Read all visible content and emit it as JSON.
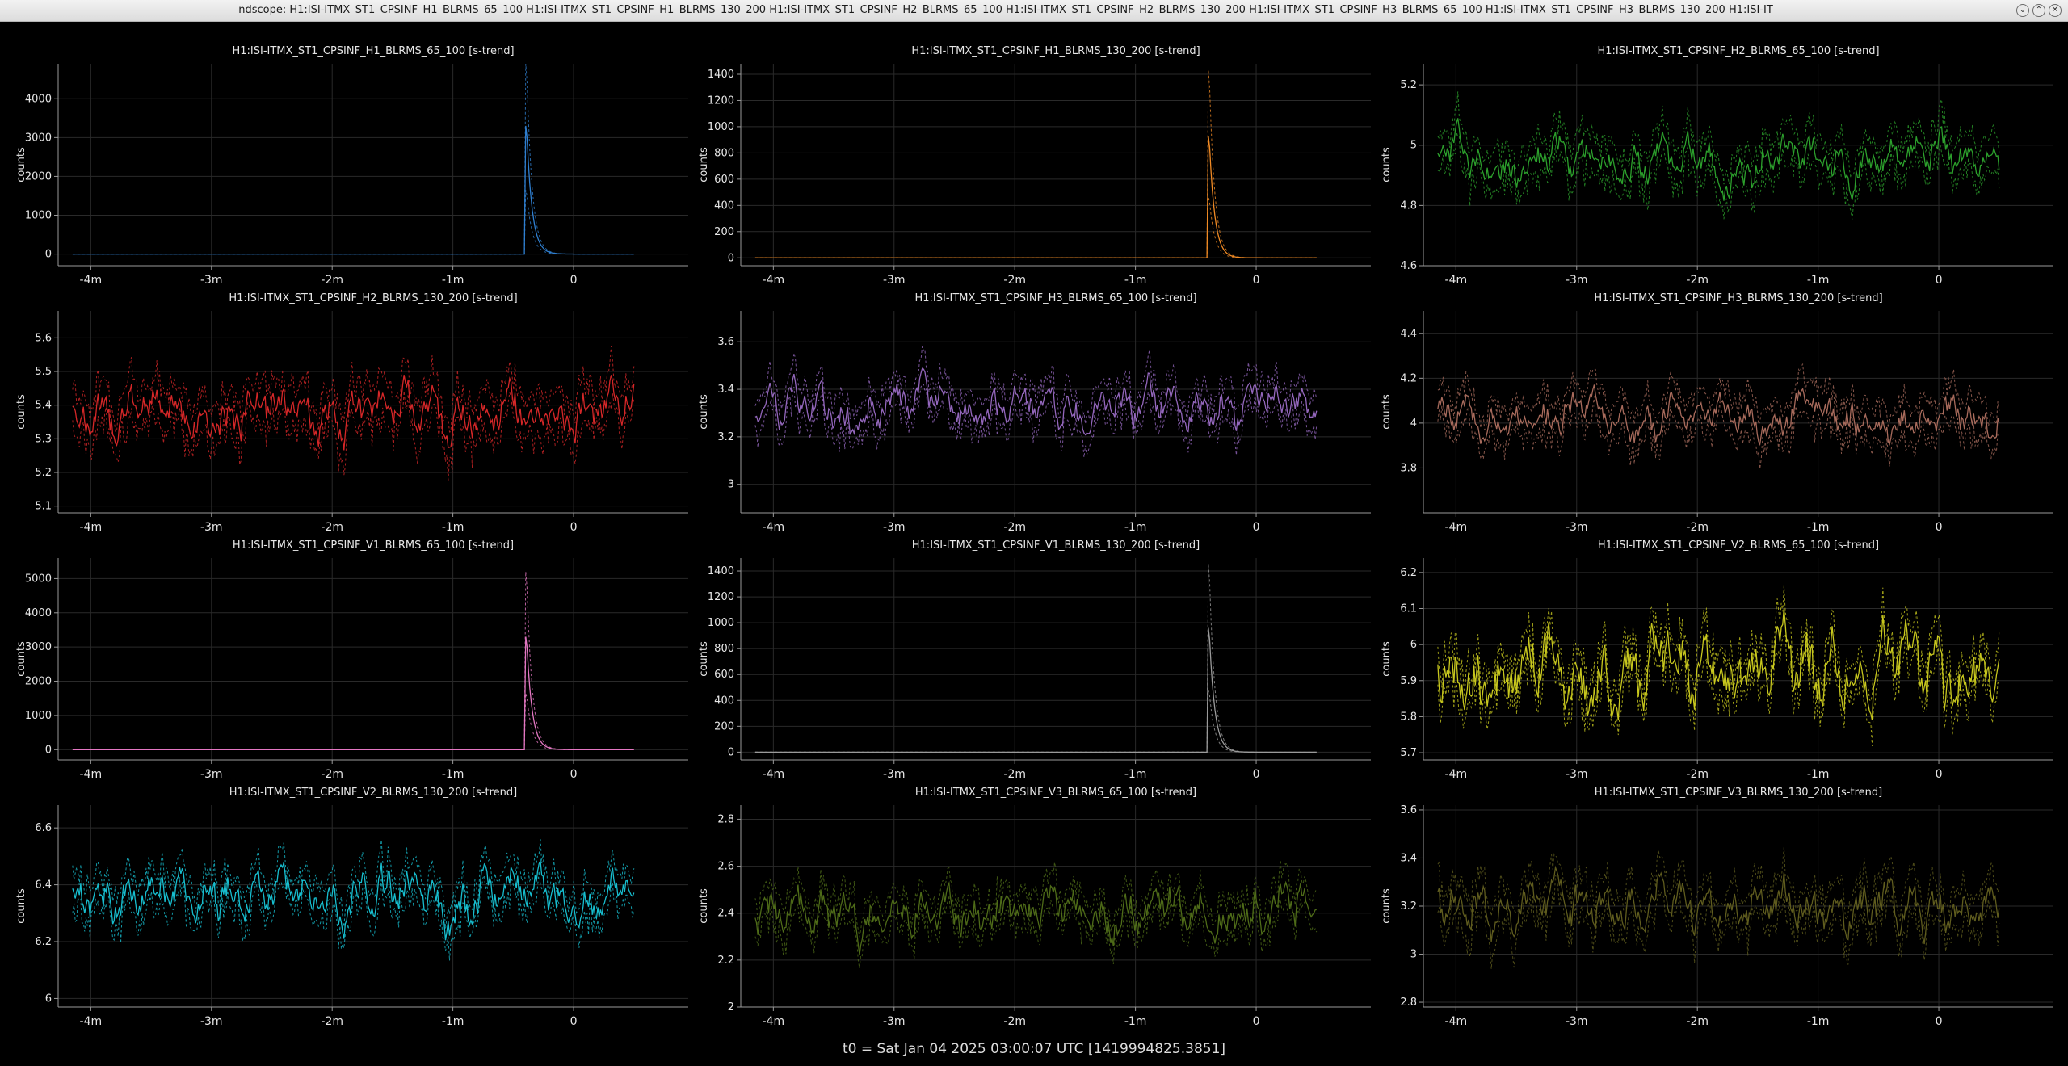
{
  "window": {
    "title": "ndscope: H1:ISI-ITMX_ST1_CPSINF_H1_BLRMS_65_100 H1:ISI-ITMX_ST1_CPSINF_H1_BLRMS_130_200 H1:ISI-ITMX_ST1_CPSINF_H2_BLRMS_65_100 H1:ISI-ITMX_ST1_CPSINF_H2_BLRMS_130_200 H1:ISI-ITMX_ST1_CPSINF_H3_BLRMS_65_100 H1:ISI-ITMX_ST1_CPSINF_H3_BLRMS_130_200 H1:ISI-IT",
    "buttons": {
      "minimize": "⌄",
      "maximize": "⌃",
      "close": "✕"
    }
  },
  "footer": {
    "t0": "t0 = Sat Jan 04 2025 03:00:07 UTC [1419994825.3851]"
  },
  "chart_data": [
    {
      "type": "line",
      "title": "H1:ISI-ITMX_ST1_CPSINF_H1_BLRMS_65_100 [s-trend]",
      "ylabel": "counts",
      "xlabel": "",
      "x_ticks": [
        "-4m",
        "-3m",
        "-2m",
        "-1m",
        "0"
      ],
      "y_ticks": [
        0,
        1000,
        2000,
        3000,
        4000
      ],
      "ylim": [
        -300,
        4900
      ],
      "xlim": [
        -4.27,
        0.95
      ],
      "color": "#2f7fd0",
      "kind": "spike",
      "baseline": 0,
      "peak_x": -0.39,
      "peak_mean": 3300,
      "peak_max": 4900,
      "peak_min": 0,
      "noise": 0,
      "grid": true
    },
    {
      "type": "line",
      "title": "H1:ISI-ITMX_ST1_CPSINF_H1_BLRMS_130_200 [s-trend]",
      "ylabel": "counts",
      "xlabel": "",
      "x_ticks": [
        "-4m",
        "-3m",
        "-2m",
        "-1m",
        "0"
      ],
      "y_ticks": [
        0,
        200,
        400,
        600,
        800,
        1000,
        1200,
        1400
      ],
      "ylim": [
        -60,
        1480
      ],
      "xlim": [
        -4.27,
        0.95
      ],
      "color": "#f08a24",
      "kind": "spike",
      "baseline": 0,
      "peak_x": -0.39,
      "peak_mean": 930,
      "peak_max": 1430,
      "peak_min": 0,
      "noise": 0,
      "grid": true
    },
    {
      "type": "line",
      "title": "H1:ISI-ITMX_ST1_CPSINF_H2_BLRMS_65_100 [s-trend]",
      "ylabel": "counts",
      "xlabel": "",
      "x_ticks": [
        "-4m",
        "-3m",
        "-2m",
        "-1m",
        "0"
      ],
      "y_ticks": [
        4.6,
        4.8,
        5,
        5.2
      ],
      "ylim": [
        4.6,
        5.27
      ],
      "xlim": [
        -4.27,
        0.95
      ],
      "color": "#2ca02c",
      "kind": "noise",
      "baseline": 4.95,
      "noise": 0.08,
      "band": 0.07,
      "seed": 3,
      "grid": true
    },
    {
      "type": "line",
      "title": "H1:ISI-ITMX_ST1_CPSINF_H2_BLRMS_130_200 [s-trend]",
      "ylabel": "counts",
      "xlabel": "",
      "x_ticks": [
        "-4m",
        "-3m",
        "-2m",
        "-1m",
        "0"
      ],
      "y_ticks": [
        5.1,
        5.2,
        5.3,
        5.4,
        5.5,
        5.6
      ],
      "ylim": [
        5.08,
        5.68
      ],
      "xlim": [
        -4.27,
        0.95
      ],
      "color": "#d62728",
      "kind": "noise",
      "baseline": 5.39,
      "noise": 0.08,
      "band": 0.07,
      "seed": 7,
      "grid": true
    },
    {
      "type": "line",
      "title": "H1:ISI-ITMX_ST1_CPSINF_H3_BLRMS_65_100 [s-trend]",
      "ylabel": "counts",
      "xlabel": "",
      "x_ticks": [
        "-4m",
        "-3m",
        "-2m",
        "-1m",
        "0"
      ],
      "y_ticks": [
        3,
        3.2,
        3.4,
        3.6
      ],
      "ylim": [
        2.88,
        3.73
      ],
      "xlim": [
        -4.27,
        0.95
      ],
      "color": "#9467bd",
      "kind": "noise",
      "baseline": 3.32,
      "noise": 0.1,
      "band": 0.08,
      "seed": 11,
      "grid": true
    },
    {
      "type": "line",
      "title": "H1:ISI-ITMX_ST1_CPSINF_H3_BLRMS_130_200 [s-trend]",
      "ylabel": "counts",
      "xlabel": "",
      "x_ticks": [
        "-4m",
        "-3m",
        "-2m",
        "-1m",
        "0"
      ],
      "y_ticks": [
        3.8,
        4,
        4.2,
        4.4
      ],
      "ylim": [
        3.6,
        4.5
      ],
      "xlim": [
        -4.27,
        0.95
      ],
      "color": "#a86b5c",
      "kind": "noise",
      "baseline": 4.02,
      "noise": 0.1,
      "band": 0.09,
      "seed": 13,
      "grid": true
    },
    {
      "type": "line",
      "title": "H1:ISI-ITMX_ST1_CPSINF_V1_BLRMS_65_100 [s-trend]",
      "ylabel": "counts",
      "xlabel": "",
      "x_ticks": [
        "-4m",
        "-3m",
        "-2m",
        "-1m",
        "0"
      ],
      "y_ticks": [
        0,
        1000,
        2000,
        3000,
        4000,
        5000
      ],
      "ylim": [
        -300,
        5600
      ],
      "xlim": [
        -4.27,
        0.95
      ],
      "color": "#e377c2",
      "kind": "spike",
      "baseline": 0,
      "peak_x": -0.39,
      "peak_mean": 3300,
      "peak_max": 5200,
      "peak_min": 0,
      "noise": 0,
      "grid": true
    },
    {
      "type": "line",
      "title": "H1:ISI-ITMX_ST1_CPSINF_V1_BLRMS_130_200 [s-trend]",
      "ylabel": "counts",
      "xlabel": "",
      "x_ticks": [
        "-4m",
        "-3m",
        "-2m",
        "-1m",
        "0"
      ],
      "y_ticks": [
        0,
        200,
        400,
        600,
        800,
        1000,
        1200,
        1400
      ],
      "ylim": [
        -60,
        1500
      ],
      "xlim": [
        -4.27,
        0.95
      ],
      "color": "#9a9a9a",
      "kind": "spike",
      "baseline": 0,
      "peak_x": -0.39,
      "peak_mean": 960,
      "peak_max": 1450,
      "peak_min": 0,
      "noise": 0,
      "grid": true
    },
    {
      "type": "line",
      "title": "H1:ISI-ITMX_ST1_CPSINF_V2_BLRMS_65_100 [s-trend]",
      "ylabel": "counts",
      "xlabel": "",
      "x_ticks": [
        "-4m",
        "-3m",
        "-2m",
        "-1m",
        "0"
      ],
      "y_ticks": [
        5.7,
        5.8,
        5.9,
        6,
        6.1,
        6.2
      ],
      "ylim": [
        5.68,
        6.24
      ],
      "xlim": [
        -4.27,
        0.95
      ],
      "color": "#c8c81e",
      "kind": "noise",
      "baseline": 5.93,
      "noise": 0.12,
      "band": 0.06,
      "seed": 17,
      "grid": true
    },
    {
      "type": "line",
      "title": "H1:ISI-ITMX_ST1_CPSINF_V2_BLRMS_130_200 [s-trend]",
      "ylabel": "counts",
      "xlabel": "",
      "x_ticks": [
        "-4m",
        "-3m",
        "-2m",
        "-1m",
        "0"
      ],
      "y_ticks": [
        6,
        6.2,
        6.4,
        6.6
      ],
      "ylim": [
        5.97,
        6.68
      ],
      "xlim": [
        -4.27,
        0.95
      ],
      "color": "#17becf",
      "kind": "noise",
      "baseline": 6.37,
      "noise": 0.1,
      "band": 0.07,
      "seed": 19,
      "grid": true
    },
    {
      "type": "line",
      "title": "H1:ISI-ITMX_ST1_CPSINF_V3_BLRMS_65_100 [s-trend]",
      "ylabel": "counts",
      "xlabel": "",
      "x_ticks": [
        "-4m",
        "-3m",
        "-2m",
        "-1m",
        "0"
      ],
      "y_ticks": [
        2,
        2.2,
        2.4,
        2.6,
        2.8
      ],
      "ylim": [
        2.0,
        2.86
      ],
      "xlim": [
        -4.27,
        0.95
      ],
      "color": "#4e6b18",
      "kind": "noise",
      "baseline": 2.4,
      "noise": 0.12,
      "band": 0.08,
      "seed": 23,
      "grid": true
    },
    {
      "type": "line",
      "title": "H1:ISI-ITMX_ST1_CPSINF_V3_BLRMS_130_200 [s-trend]",
      "ylabel": "counts",
      "xlabel": "",
      "x_ticks": [
        "-4m",
        "-3m",
        "-2m",
        "-1m",
        "0"
      ],
      "y_ticks": [
        2.8,
        3,
        3.2,
        3.4,
        3.6
      ],
      "ylim": [
        2.78,
        3.62
      ],
      "xlim": [
        -4.27,
        0.95
      ],
      "color": "#5f5c1e",
      "kind": "noise",
      "baseline": 3.2,
      "noise": 0.12,
      "band": 0.09,
      "seed": 29,
      "grid": true
    }
  ]
}
